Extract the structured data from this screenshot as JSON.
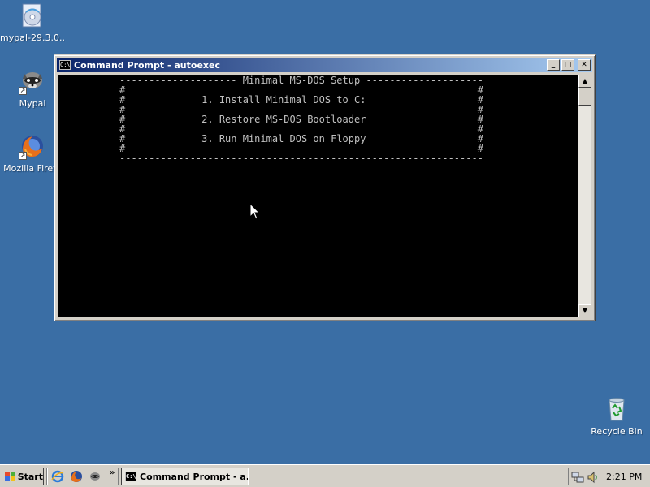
{
  "desktop": {
    "icons": [
      {
        "label": "mypal-29.3.0...",
        "icon": "installer-cd-icon"
      },
      {
        "label": "Mypal",
        "icon": "mypal-raccoon-icon"
      },
      {
        "label": "Mozilla Firefo",
        "icon": "firefox-icon"
      },
      {
        "label": "Recycle Bin",
        "icon": "recycle-bin-icon"
      }
    ]
  },
  "window": {
    "title": "Command Prompt - autoexec",
    "title_icon_text": "C:\\",
    "controls": {
      "minimize": "_",
      "maximize": "□",
      "close": "✕"
    },
    "console_lines": [
      "-------------------- Minimal MS-DOS Setup --------------------",
      "#                                                            #",
      "#             1. Install Minimal DOS to C:                   #",
      "#                                                            #",
      "#             2. Restore MS-DOS Bootloader                   #",
      "#                                                            #",
      "#             3. Run Minimal DOS on Floppy                   #",
      "#                                                            #",
      "--------------------------------------------------------------"
    ],
    "scrollbar": {
      "up": "▲",
      "down": "▼"
    }
  },
  "taskbar": {
    "start_label": "Start",
    "quick_launch": [
      "ie-icon",
      "firefox-icon",
      "mypal-raccoon-icon"
    ],
    "chevron": "»",
    "task_button_label": "Command Prompt - a...",
    "tray_icons": [
      "network-icon",
      "volume-icon"
    ],
    "clock": "2:21 PM"
  },
  "colors": {
    "desktop": "#3a6ea5",
    "title_gradient_start": "#0a246a",
    "title_gradient_end": "#a6caf0",
    "console_bg": "#000000",
    "console_text": "#c0c0c0",
    "chrome": "#d4d0c8"
  }
}
